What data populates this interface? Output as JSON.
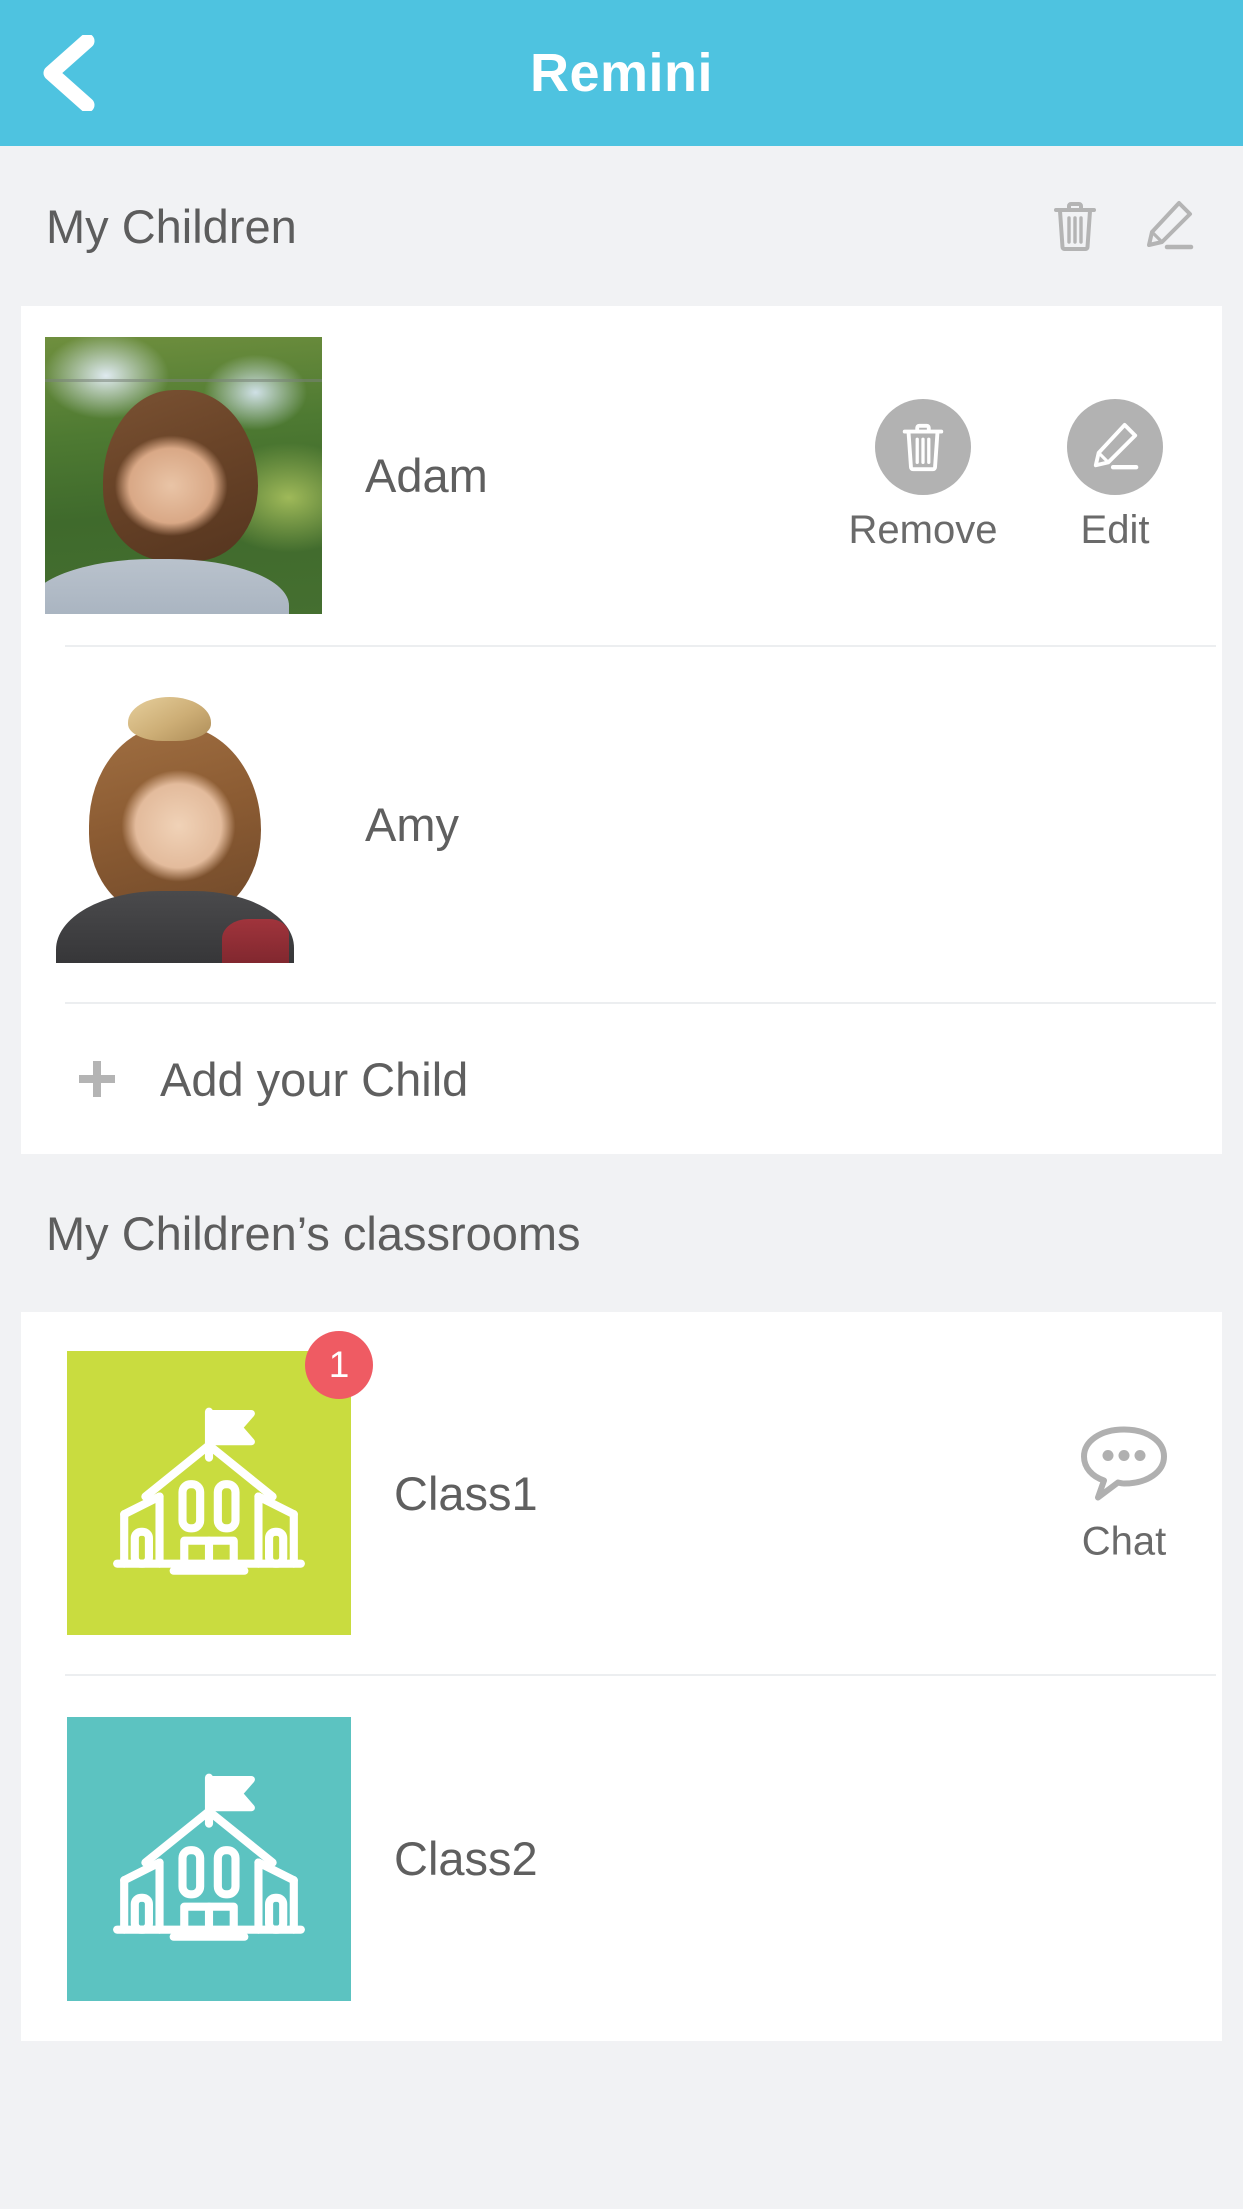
{
  "appbar": {
    "title": "Remini",
    "back_icon": "chevron-left-icon",
    "background_color": "#4ec3e0",
    "title_color": "#ffffff"
  },
  "children_section": {
    "title": "My Children",
    "actions": [
      {
        "icon": "trash-icon",
        "name": "delete-children-icon"
      },
      {
        "icon": "pencil-icon",
        "name": "edit-children-icon"
      }
    ],
    "children": [
      {
        "name": "Adam",
        "photo_alt": "photo-of-adam",
        "actions": [
          {
            "label": "Remove",
            "icon": "trash-icon"
          },
          {
            "label": "Edit",
            "icon": "pencil-icon"
          }
        ]
      },
      {
        "name": "Amy",
        "photo_alt": "photo-of-amy",
        "actions": []
      }
    ],
    "add_row": {
      "label": "Add your Child",
      "icon": "plus-icon"
    }
  },
  "classrooms_section": {
    "title": "My Children’s classrooms",
    "classrooms": [
      {
        "name": "Class1",
        "tile_color": "#c9dc3f",
        "badge": "1",
        "badge_color": "#ef5b63",
        "chat_label": "Chat",
        "chat_icon": "chat-bubble-icon",
        "school_icon": "school-building-icon"
      },
      {
        "name": "Class2",
        "tile_color": "#5cc3c1",
        "badge": null,
        "chat_label": null,
        "school_icon": "school-building-icon"
      }
    ]
  },
  "theme": {
    "page_background": "#f1f2f4",
    "card_background": "#ffffff",
    "text_color": "#5f5f5f",
    "muted_icon_color": "#b2b2b2"
  }
}
